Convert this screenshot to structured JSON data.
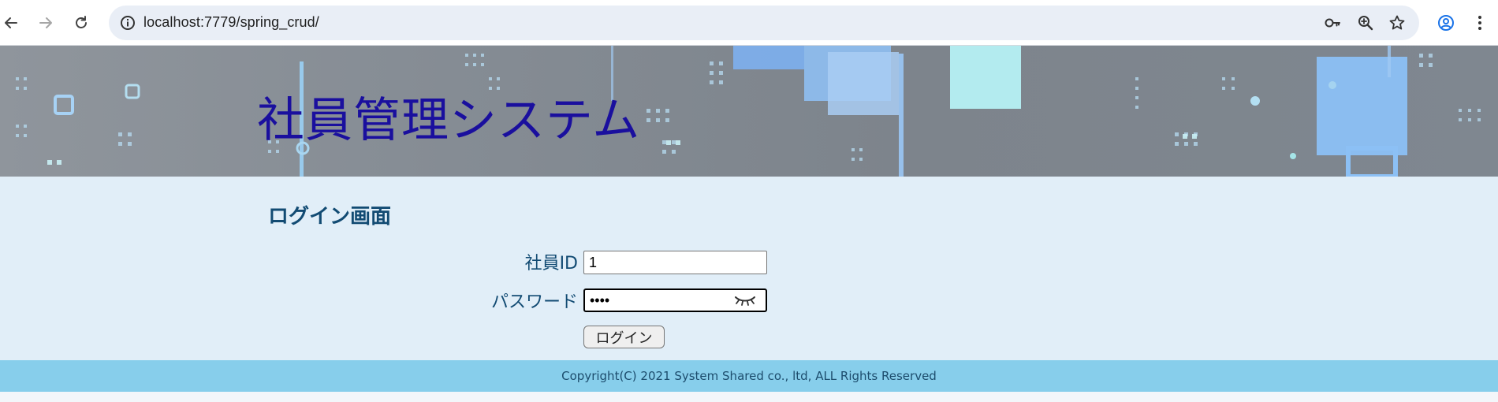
{
  "browser": {
    "url": "localhost:7779/spring_crud/",
    "icons": {
      "back": "arrow-left-icon",
      "forward": "arrow-right-icon",
      "reload": "reload-icon",
      "site_info": "info-icon",
      "password_key": "key-icon",
      "zoom": "zoom-icon",
      "bookmark": "star-icon",
      "profile": "profile-icon",
      "menu": "kebab-menu-icon"
    }
  },
  "header": {
    "title": "社員管理システム",
    "title_color": "#1a0f9e"
  },
  "login": {
    "heading": "ログイン画面",
    "employee_id_label": "社員ID",
    "employee_id_value": "1",
    "password_label": "パスワード",
    "password_value": "••••",
    "submit_label": "ログイン"
  },
  "footer": {
    "copyright": "Copyright(C) 2021 System Shared co., ltd, ALL Rights Reserved",
    "background": "#87ceeb"
  },
  "colors": {
    "main_background": "#e1eef8",
    "label_color": "#124b73"
  }
}
